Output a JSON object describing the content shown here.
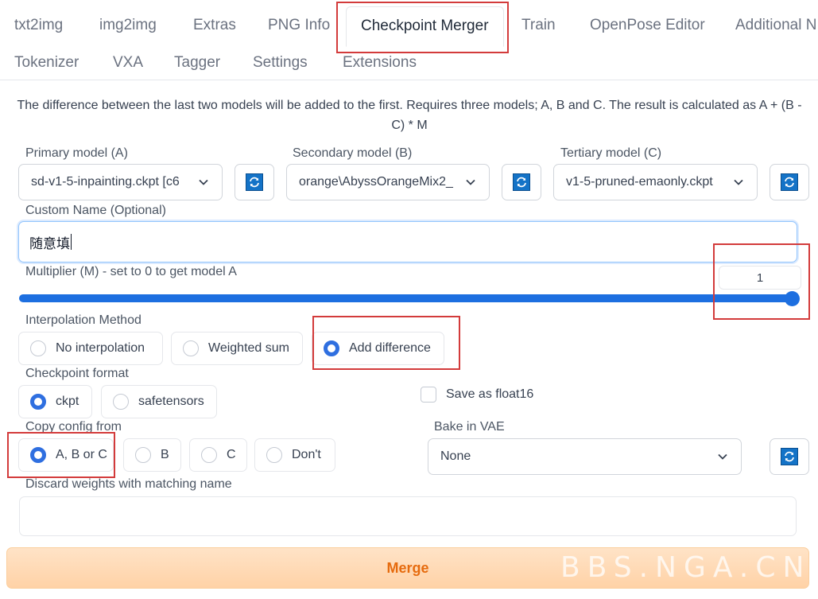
{
  "tabs": {
    "row1": [
      "txt2img",
      "img2img",
      "Extras",
      "PNG Info",
      "Checkpoint Merger",
      "Train",
      "OpenPose Editor",
      "Additional N"
    ],
    "row2": [
      "Tokenizer",
      "VXA",
      "Tagger",
      "Settings",
      "Extensions"
    ]
  },
  "description": "The difference between the last two models will be added to the first. Requires three models; A, B and C. The result is calculated as A + (B - C) * M",
  "models": {
    "primary": {
      "label": "Primary model (A)",
      "value": "sd-v1-5-inpainting.ckpt [c6"
    },
    "secondary": {
      "label": "Secondary model (B)",
      "value": "orange\\AbyssOrangeMix2_"
    },
    "tertiary": {
      "label": "Tertiary model (C)",
      "value": "v1-5-pruned-emaonly.ckpt"
    }
  },
  "custom_name": {
    "label": "Custom Name (Optional)",
    "value": "随意填"
  },
  "multiplier": {
    "label": "Multiplier (M) - set to 0 to get model A",
    "value": "1",
    "fraction": 1.0
  },
  "interpolation": {
    "label": "Interpolation Method",
    "options": [
      "No interpolation",
      "Weighted sum",
      "Add difference"
    ],
    "selected": "Add difference"
  },
  "checkpoint_format": {
    "label": "Checkpoint format",
    "options": [
      "ckpt",
      "safetensors"
    ],
    "selected": "ckpt"
  },
  "save_float16": {
    "label": "Save as float16",
    "checked": false
  },
  "copy_config": {
    "label": "Copy config from",
    "options": [
      "A, B or C",
      "B",
      "C",
      "Don't"
    ],
    "selected": "A, B or C"
  },
  "bake_vae": {
    "label": "Bake in VAE",
    "value": "None"
  },
  "discard_weights": {
    "label": "Discard weights with matching name",
    "value": ""
  },
  "merge_button": {
    "label": "Merge"
  },
  "watermark": "BBS.NGA.CN",
  "colors": {
    "accent": "#2f6fe0",
    "merge_text": "#e66b0e",
    "highlight_box": "#d33b3b"
  }
}
